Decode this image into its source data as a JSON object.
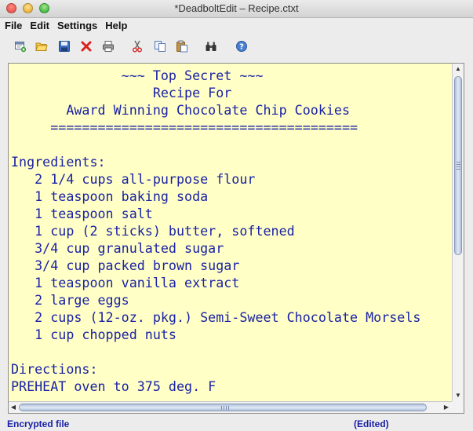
{
  "window": {
    "title": "*DeadboltEdit – Recipe.ctxt"
  },
  "menu": [
    "File",
    "Edit",
    "Settings",
    "Help"
  ],
  "toolbar": {
    "icons": [
      "new-file-icon",
      "open-folder-icon",
      "save-icon",
      "delete-icon",
      "print-icon",
      "cut-icon",
      "copy-icon",
      "paste-icon",
      "find-icon",
      "help-icon"
    ]
  },
  "editor": {
    "background": "#ffffc6",
    "text_color": "#1a22a5",
    "lines": [
      "              ~~~ Top Secret ~~~",
      "                  Recipe For",
      "       Award Winning Chocolate Chip Cookies",
      "     =======================================",
      "",
      "Ingredients:",
      "   2 1/4 cups all-purpose flour",
      "   1 teaspoon baking soda",
      "   1 teaspoon salt",
      "   1 cup (2 sticks) butter, softened",
      "   3/4 cup granulated sugar",
      "   3/4 cup packed brown sugar",
      "   1 teaspoon vanilla extract",
      "   2 large eggs",
      "   2 cups (12-oz. pkg.) Semi-Sweet Chocolate Morsels",
      "   1 cup chopped nuts",
      "",
      "Directions:",
      "PREHEAT oven to 375 deg. F"
    ]
  },
  "status": {
    "left": "Encrypted file",
    "right": "(Edited)"
  }
}
